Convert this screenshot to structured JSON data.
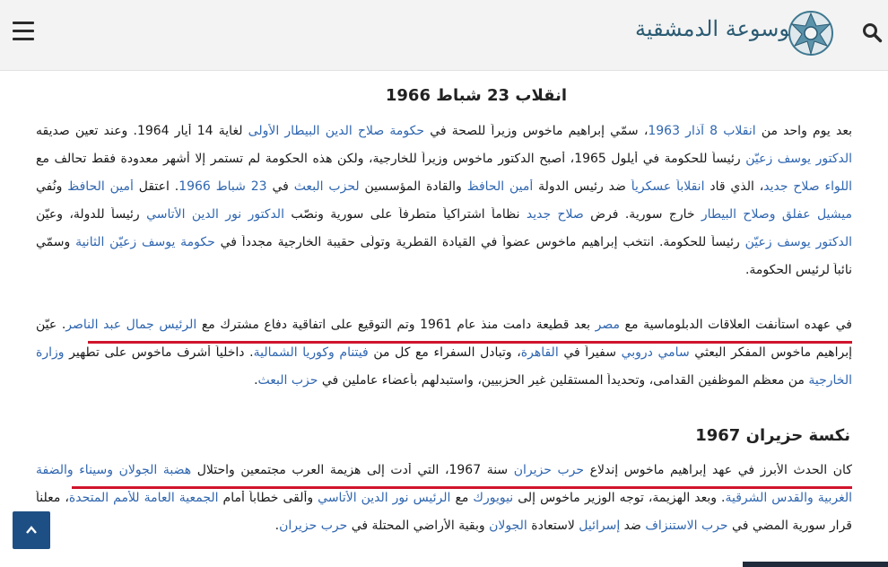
{
  "sections": [
    {
      "heading": "انقلاب 23 شباط 1966",
      "lines": [
        [
          {
            "t": "بعد يوم واحد من "
          },
          {
            "t": "انقلاب 8 آذار 1963",
            "link": true
          },
          {
            "t": "، سمّي إبراهيم ماخوس وزيراً للصحة في "
          },
          {
            "t": "حكومة صلاح الدين البيطار الأولى",
            "link": true
          },
          {
            "t": " لغاية 14 أيار 1964. وعند تعين صديقه"
          }
        ],
        [
          {
            "t": "الدكتور يوسف زعيّن",
            "link": true
          },
          {
            "t": " رئيساً للحكومة في أيلول 1965، أصبح الدكتور ماخوس وزيراً للخارجية، ولكن هذه الحكومة لم تستمر إلا أشهر معدودة فقط تحالف مع"
          }
        ],
        [
          {
            "t": "اللواء صلاح جديد",
            "link": true
          },
          {
            "t": "، الذي قاد "
          },
          {
            "t": "انقلاباً عسكرياً",
            "link": true
          },
          {
            "t": " ضد رئيس الدولة "
          },
          {
            "t": "أمين الحافظ",
            "link": true
          },
          {
            "t": " والقادة المؤسسين "
          },
          {
            "t": "لحزب البعث",
            "link": true
          },
          {
            "t": " في "
          },
          {
            "t": "23 شباط 1966",
            "link": true
          },
          {
            "t": ". اعتقل "
          },
          {
            "t": "أمين الحافظ",
            "link": true
          },
          {
            "t": " ونُفي"
          }
        ],
        [
          {
            "t": "ميشيل عفلق وصلاح البيطار",
            "link": true
          },
          {
            "t": " خارج سورية. فرض "
          },
          {
            "t": "صلاح جديد",
            "link": true
          },
          {
            "t": " نظاماً اشتراكياً متطرفاً على سورية ونصّب "
          },
          {
            "t": "الدكتور نور الدين الأتاسي",
            "link": true
          },
          {
            "t": " رئيساً للدولة، وعيّن"
          }
        ],
        [
          {
            "t": "الدكتور يوسف زعيّن",
            "link": true
          },
          {
            "t": " رئيساً للحكومة. انتخب إبراهيم ماخوس عضواً في القيادة القطرية وتولّى حقيبة الخارجية مجدداً في "
          },
          {
            "t": "حكومة يوسف زعيّن الثانية",
            "link": true
          },
          {
            "t": " وسمّي"
          }
        ],
        [
          {
            "t": "نائباً لرئيس الحكومة."
          }
        ]
      ]
    },
    {
      "heading": "",
      "lines": [
        [
          {
            "t": "في عهده استأنفت العلاقات الدبلوماسية مع "
          },
          {
            "t": "مصر",
            "link": true
          },
          {
            "t": " بعد قطيعة دامت منذ عام 1961 وتم التوقيع على اتفاقية دفاع مشترك مع "
          },
          {
            "t": "الرئيس جمال عبد الناصر",
            "link": true
          },
          {
            "t": ". عيّن"
          }
        ],
        [
          {
            "t": "إبراهيم ماخوس المفكر البعثي "
          },
          {
            "t": "سامي دروبي",
            "link": true
          },
          {
            "t": " سفيراً في "
          },
          {
            "t": "القاهرة",
            "link": true
          },
          {
            "t": "، وتبادل السفراء مع كل من "
          },
          {
            "t": "فيتنام وكوريا الشمالية",
            "link": true
          },
          {
            "t": ". داخلياً أشرف ماخوس على تطهير "
          },
          {
            "t": "وزارة",
            "link": true
          }
        ],
        [
          {
            "t": "الخارجية",
            "link": true
          },
          {
            "t": " من معظم الموظفين القدامى، وتحديداً المستقلين غير الحزبيين، واستبدلهم بأعضاء عاملين في "
          },
          {
            "t": "حزب البعث",
            "link": true
          },
          {
            "t": "."
          }
        ]
      ]
    },
    {
      "heading": "نكسة حزيران 1967",
      "lines": [
        [
          {
            "t": "كان الحدث الأبرز في عهد إبراهيم ماخوس إندلاع "
          },
          {
            "t": "حرب حزيران",
            "link": true
          },
          {
            "t": " سنة 1967، التي أدت إلى هزيمة العرب مجتمعين واحتلال "
          },
          {
            "t": "هضبة الجولان وسيناء  والضفة",
            "link": true
          }
        ],
        [
          {
            "t": "الغربية والقدس الشرقية",
            "link": true
          },
          {
            "t": ". وبعد الهزيمة، توجه الوزير ماخوس إلى "
          },
          {
            "t": "نيويورك",
            "link": true
          },
          {
            "t": " مع "
          },
          {
            "t": "الرئيس نور الدين الأتاسي",
            "link": true
          },
          {
            "t": " وألقى خطاباً أمام "
          },
          {
            "t": "الجمعية العامة للأمم المتحدة",
            "link": true
          },
          {
            "t": "، معلناً"
          }
        ],
        [
          {
            "t": "قرار سورية المضي في "
          },
          {
            "t": "حرب الاستنزاف",
            "link": true
          },
          {
            "t": " ضد "
          },
          {
            "t": "إسرائيل",
            "link": true
          },
          {
            "t": " لاستعادة "
          },
          {
            "t": "الجولان",
            "link": true
          },
          {
            "t": " وبقية الأراضي المحتلة في "
          },
          {
            "t": "حرب حزيران",
            "link": true
          },
          {
            "t": "."
          }
        ]
      ]
    }
  ],
  "logo": {
    "text": "الموسوعة الدمشقية"
  },
  "colors": {
    "link": "#2f66b0",
    "underline": "#d0142c",
    "header_bg": "#f3f3f3",
    "top_button": "#1e4f84"
  },
  "icons": {
    "search": "search-icon",
    "menu": "hamburger-menu-icon",
    "scroll_top": "chevron-up-icon"
  }
}
